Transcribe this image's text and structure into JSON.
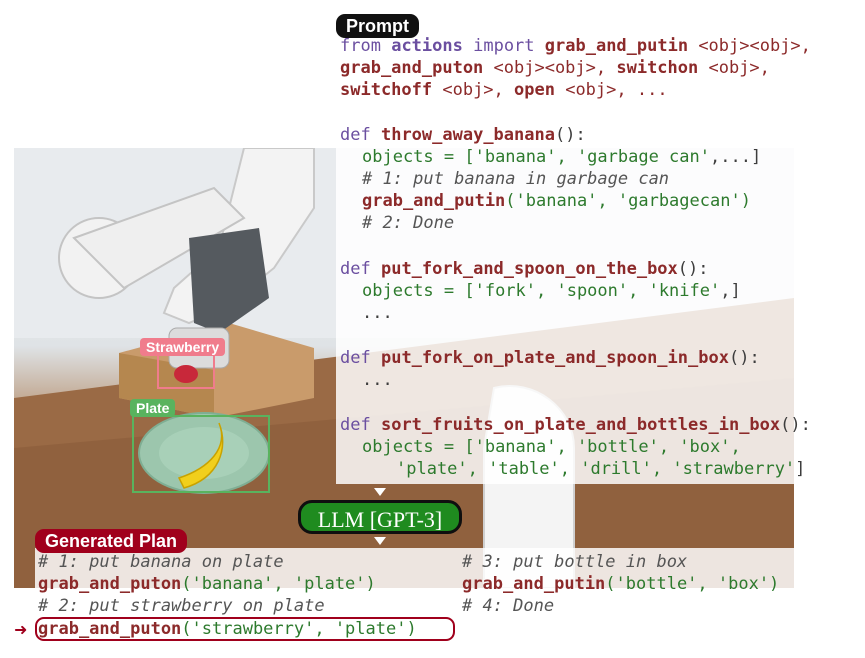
{
  "prompt_tag": "Prompt",
  "generated_plan_tag": "Generated Plan",
  "llm_label": "LLM [GPT-3]",
  "colors": {
    "prompt_tag_bg": "#111111",
    "plan_tag_bg": "#a0001c",
    "llm_bg": "#1f8b1f",
    "keyword": "#6b4fa0",
    "function": "#8c2a2a",
    "string": "#2d7a2d",
    "strawberry_box": "#f07c8c",
    "plate_box": "#59b35e"
  },
  "bbox_labels": {
    "strawberry": "Strawberry",
    "plate": "Plate"
  },
  "prompt_code": {
    "l1a": "from",
    "l1b": "actions",
    "l1c": "import",
    "l1d": "grab_and_putin",
    "l1e": " <obj><obj>,",
    "l2a": "grab_and_puton",
    "l2b": " <obj><obj>, ",
    "l2c": "switchon",
    "l2d": " <obj>,",
    "l3a": "switchoff",
    "l3b": " <obj>, ",
    "l3c": "open",
    "l3d": " <obj>, ...",
    "f1_def": "def",
    "f1_name": "throw_away_banana",
    "f1_paren": "():",
    "f1_obj_a": "objects = [",
    "f1_obj_b": "'banana', 'garbage can'",
    "f1_obj_c": ",...]",
    "f1_c1": "# 1: put banana in garbage can",
    "f1_call_fn": "grab_and_putin",
    "f1_call_args": "('banana', 'garbagecan')",
    "f1_c2": "# 2: Done",
    "f2_def": "def",
    "f2_name": "put_fork_and_spoon_on_the_box",
    "f2_paren": "():",
    "f2_obj_a": "objects = [",
    "f2_obj_b": "'fork', 'spoon', 'knife'",
    "f2_obj_c": ",]",
    "f2_dots": "...",
    "f3_def": "def",
    "f3_name": "put_fork_on_plate_and_spoon_in_box",
    "f3_paren": "():",
    "f3_dots": "...",
    "f4_def": "def",
    "f4_name": "sort_fruits_on_plate_and_bottles_in_box",
    "f4_paren": "():",
    "f4_obj_a": "objects = [",
    "f4_obj_b": "'banana', 'bottle', 'box',",
    "f4_obj_c": "'plate', 'table', 'drill', 'strawberry'",
    "f4_obj_d": "]"
  },
  "plan": {
    "c1": "# 1: put banana on plate",
    "p1_fn": "grab_and_puton",
    "p1_args": "('banana', 'plate')",
    "c2": "# 2: put strawberry on plate",
    "p2_fn": "grab_and_puton",
    "p2_args": "('strawberry', 'plate')",
    "c3": "# 3: put bottle in box",
    "p3_fn": "grab_and_putin",
    "p3_args": "('bottle', 'box')",
    "c4": "# 4: Done"
  }
}
